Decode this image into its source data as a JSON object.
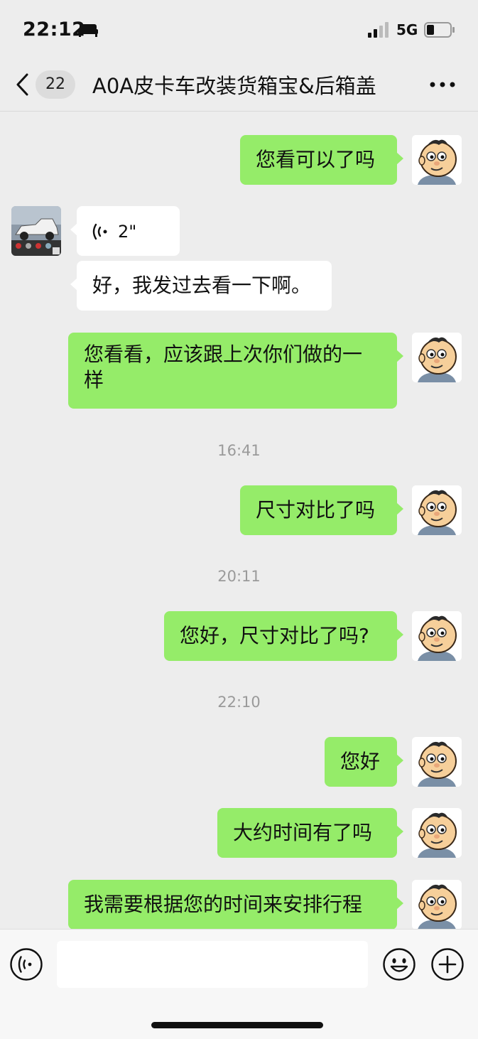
{
  "status_bar": {
    "time": "22:12",
    "network": "5G"
  },
  "header": {
    "unread_count": "22",
    "title": "A0A皮卡车改装货箱宝&后箱盖"
  },
  "messages": [
    {
      "from": "me",
      "text": "您看可以了吗"
    },
    {
      "from": "other",
      "type": "voice",
      "duration": "2\""
    },
    {
      "from": "other",
      "text": "好，我发过去看一下啊。"
    },
    {
      "from": "me",
      "text_line1": "您看看，应该跟上次你们做的一",
      "text_line2": "样"
    },
    {
      "type": "time",
      "text": "16:41"
    },
    {
      "from": "me",
      "text": "尺寸对比了吗"
    },
    {
      "type": "time",
      "text": "20:11"
    },
    {
      "from": "me",
      "text": "您好，尺寸对比了吗?"
    },
    {
      "type": "time",
      "text": "22:10"
    },
    {
      "from": "me",
      "text": "您好"
    },
    {
      "from": "me",
      "text": "大约时间有了吗"
    },
    {
      "from": "me",
      "text": "我需要根据您的时间来安排行程"
    }
  ],
  "input_bar": {
    "placeholder": ""
  },
  "colors": {
    "my_bubble": "#95ec69",
    "their_bubble": "#ffffff",
    "background": "#ededed"
  }
}
